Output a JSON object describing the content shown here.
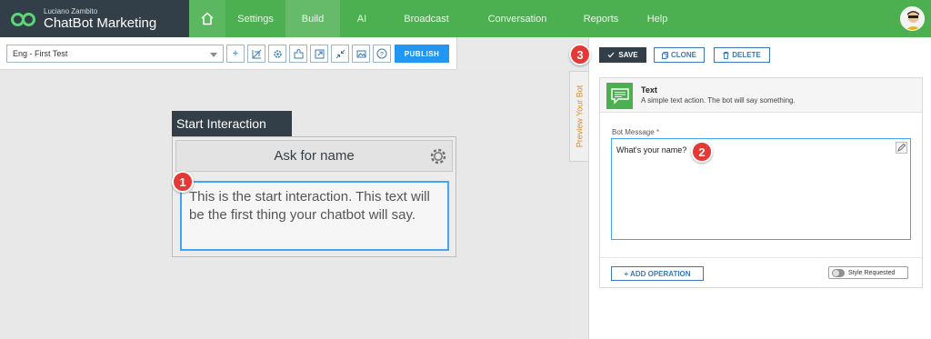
{
  "brand": {
    "subtitle": "Luciano Zambito",
    "title": "ChatBot Marketing"
  },
  "nav": {
    "home_icon": "home-icon",
    "items": [
      {
        "label": "Settings",
        "active": false
      },
      {
        "label": "Build",
        "active": true
      },
      {
        "label": "AI",
        "active": false
      },
      {
        "label": "Broadcast",
        "active": false
      },
      {
        "label": "Conversation",
        "active": false
      },
      {
        "label": "Reports",
        "active": false
      },
      {
        "label": "Help",
        "active": false
      }
    ]
  },
  "toolbar": {
    "bot_select": "Eng - First Test",
    "add_label": "+",
    "publish_label": "PUBLISH"
  },
  "canvas": {
    "node_tab": "Start Interaction",
    "node_title": "Ask for name",
    "node_text": "This is the start interaction. This text will be the first thing your chatbot will say."
  },
  "preview_tab": "Preview Your Bot",
  "panel": {
    "save_label": "SAVE",
    "clone_label": "CLONE",
    "delete_label": "DELETE",
    "card_title": "Text",
    "card_desc": "A simple text action. The bot will say something.",
    "field_label": "Bot Message",
    "required_mark": "*",
    "message_value": "What's your name?",
    "add_operation_label": "+ ADD OPERATION",
    "style_requested_label": "Style Requested"
  },
  "badges": [
    "1",
    "2",
    "3"
  ],
  "colors": {
    "topbar": "#4caf50",
    "brand_bg": "#333f48",
    "accent_blue": "#2196f3",
    "badge_red": "#e53935",
    "preview_orange": "#d98b2b"
  }
}
